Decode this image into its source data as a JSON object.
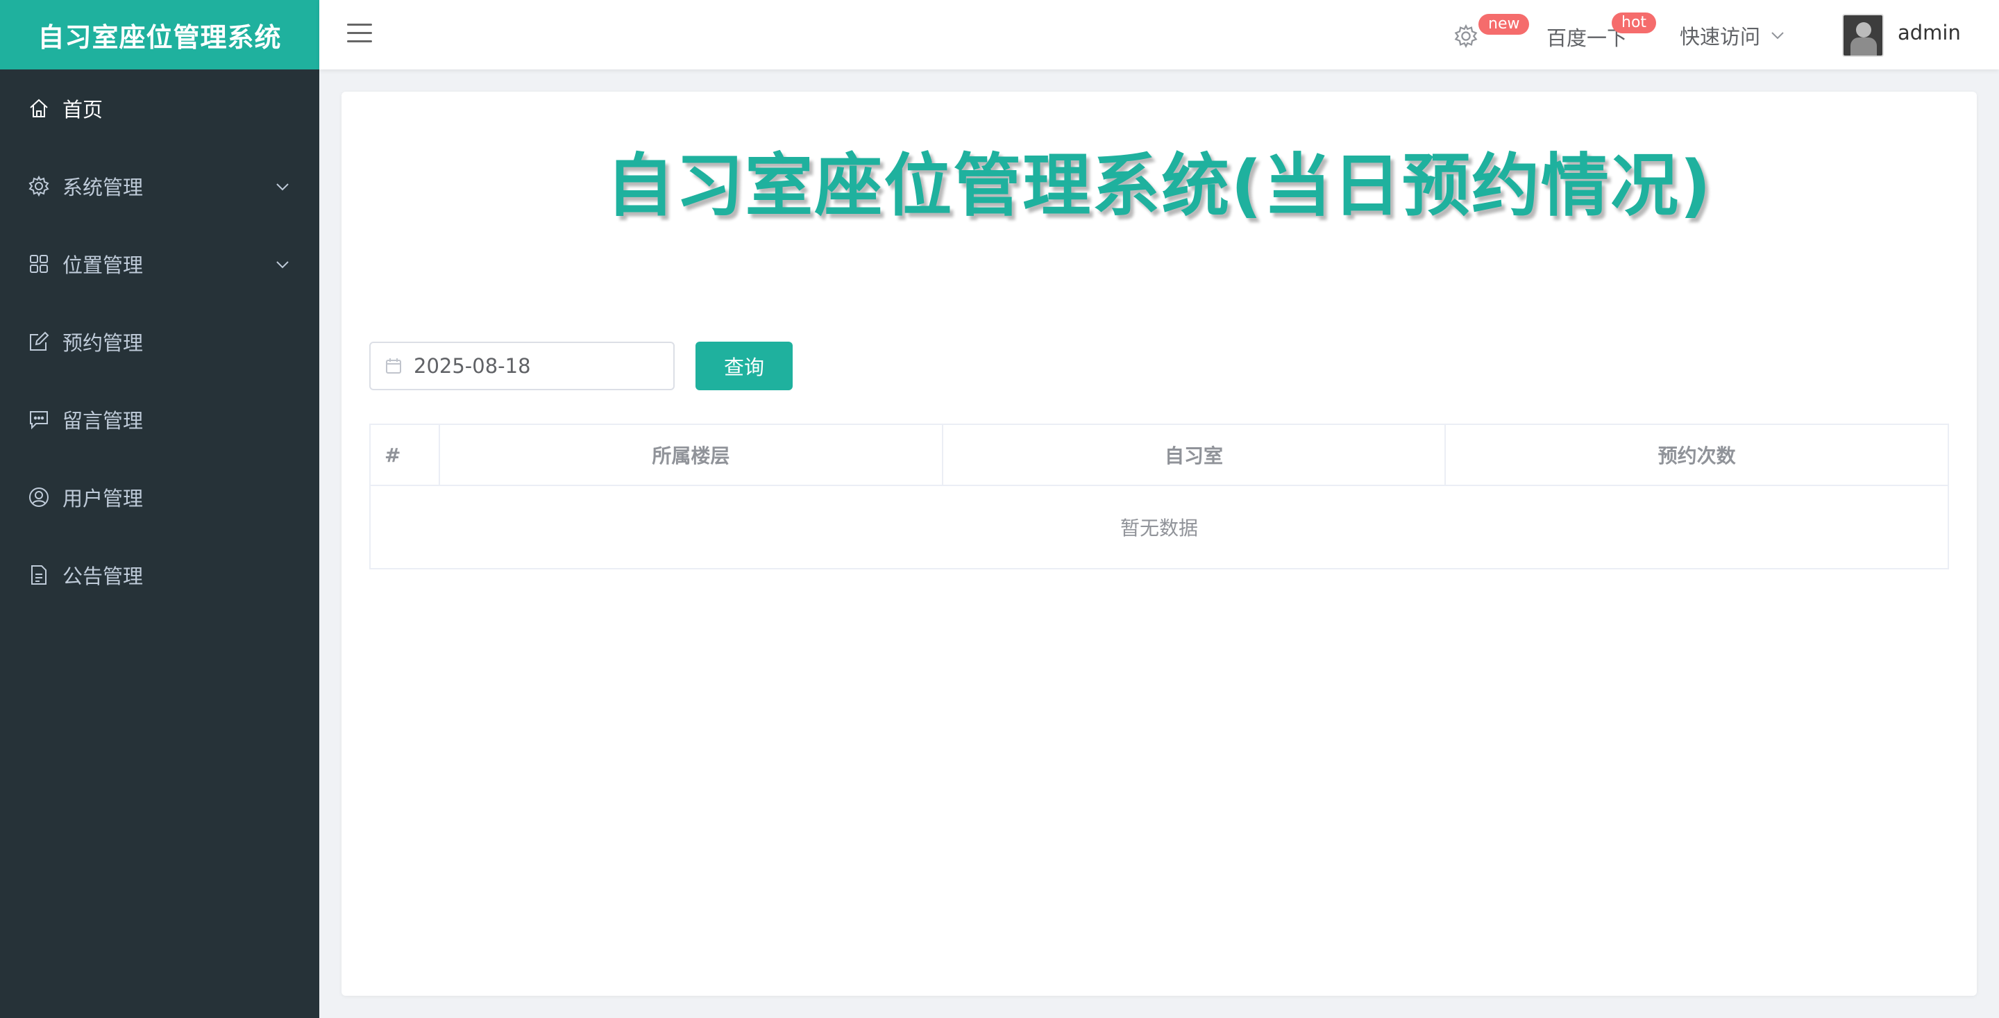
{
  "app": {
    "title": "自习室座位管理系统"
  },
  "sidebar": {
    "items": [
      {
        "label": "首页"
      },
      {
        "label": "系统管理"
      },
      {
        "label": "位置管理"
      },
      {
        "label": "预约管理"
      },
      {
        "label": "留言管理"
      },
      {
        "label": "用户管理"
      },
      {
        "label": "公告管理"
      }
    ]
  },
  "header": {
    "badge_new": "new",
    "baidu_label": "百度一下",
    "badge_hot": "hot",
    "quick_access": "快速访问",
    "username": "admin"
  },
  "main": {
    "heading": "自习室座位管理系统(当日预约情况)",
    "date_value": "2025-08-18",
    "query_button": "查询",
    "table": {
      "columns": [
        "#",
        "所属楼层",
        "自习室",
        "预约次数"
      ],
      "rows": [],
      "empty_text": "暂无数据"
    }
  },
  "colors": {
    "accent": "#1fb19e",
    "sidebar_bg": "#263238",
    "badge": "#f56c6c"
  }
}
